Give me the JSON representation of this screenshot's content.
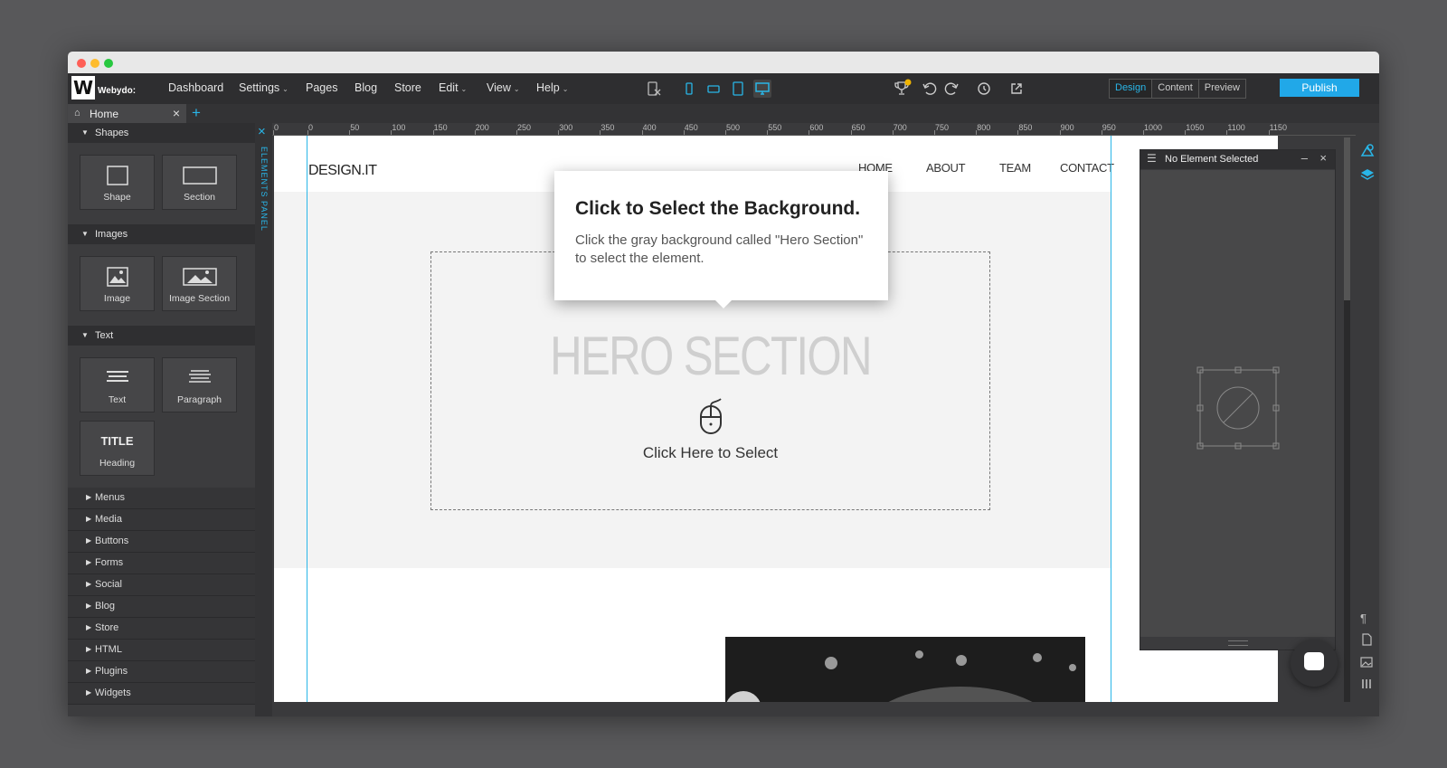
{
  "app": {
    "logo_letter": "W",
    "logo_text": "Webydo:"
  },
  "menu": {
    "items": [
      {
        "label": "Dashboard",
        "dropdown": false
      },
      {
        "label": "Settings",
        "dropdown": true
      },
      {
        "label": "Pages",
        "dropdown": false
      },
      {
        "label": "Blog",
        "dropdown": false
      },
      {
        "label": "Store",
        "dropdown": false
      },
      {
        "label": "Edit",
        "dropdown": true
      },
      {
        "label": "View",
        "dropdown": true
      },
      {
        "label": "Help",
        "dropdown": true
      }
    ]
  },
  "devices": [
    "mobile-portrait-icon",
    "mobile-landscape-icon",
    "tablet-icon",
    "desktop-icon"
  ],
  "active_device": "desktop",
  "modes": [
    "Design",
    "Content",
    "Preview"
  ],
  "active_mode": "Design",
  "publish_label": "Publish",
  "tab": {
    "label": "Home"
  },
  "elements_panel": {
    "vertical_label": "ELEMENTS PANEL",
    "sections": [
      {
        "label": "Shapes",
        "items": [
          "Shape",
          "Section"
        ]
      },
      {
        "label": "Images",
        "items": [
          "Image",
          "Image Section"
        ]
      },
      {
        "label": "Text",
        "items": [
          "Text",
          "Paragraph",
          "Heading"
        ]
      }
    ],
    "heading_glyph": "TITLE",
    "collapsed": [
      "Menus",
      "Media",
      "Buttons",
      "Forms",
      "Social",
      "Blog",
      "Store",
      "HTML",
      "Plugins",
      "Widgets"
    ]
  },
  "ruler_labels": [
    "0",
    "0",
    "50",
    "100",
    "150",
    "200",
    "250",
    "300",
    "350",
    "400",
    "450",
    "500",
    "550",
    "600",
    "650",
    "700",
    "750",
    "800",
    "850",
    "900",
    "950",
    "1000",
    "1050",
    "1100",
    "1150"
  ],
  "site": {
    "logo": "DESIGN.IT",
    "nav": [
      "HOME",
      "ABOUT",
      "TEAM",
      "CONTACT"
    ],
    "hero_title": "HERO SECTION",
    "click_here": "Click Here to Select"
  },
  "tooltip": {
    "title": "Click to Select the Background.",
    "body": "Click the gray background called \"Hero Section\" to select the element."
  },
  "properties_panel": {
    "title": "No Element Selected"
  },
  "colors": {
    "accent": "#29b6e8",
    "publish": "#21a8e8",
    "dark_bg": "#3a3a3c"
  }
}
